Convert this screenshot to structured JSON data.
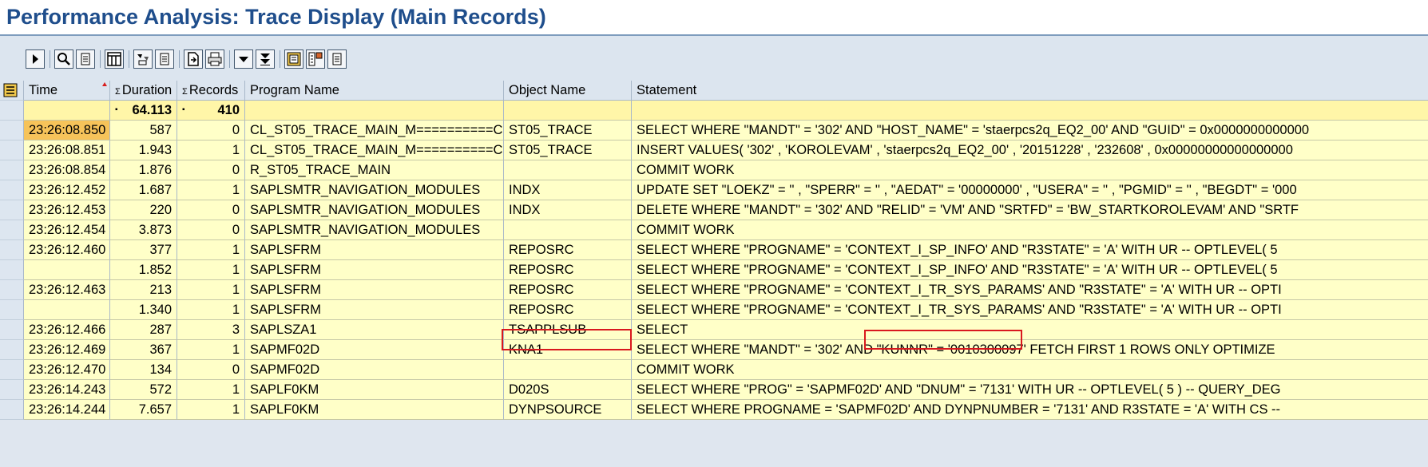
{
  "window": {
    "title": "Performance Analysis: Trace Display (Main Records)"
  },
  "toolbar": {
    "buttons": [
      "execute-icon",
      "details-icon",
      "layout-icon",
      "filter-icon",
      "export-icon",
      "print-icon",
      "dropdown-icon",
      "expand-all-icon",
      "chart-icon",
      "settings-icon"
    ]
  },
  "table": {
    "columns": {
      "time": "Time",
      "duration": "Duration",
      "records": "Records",
      "program": "Program Name",
      "object": "Object Name",
      "statement": "Statement"
    },
    "totals": {
      "duration": "64.113",
      "records": "410"
    },
    "rows": [
      {
        "time": "23:26:08.850",
        "duration": "587",
        "records": "0",
        "program": "CL_ST05_TRACE_MAIN_M==========CP",
        "object": "ST05_TRACE",
        "statement": "SELECT  WHERE \"MANDT\" = '302' AND \"HOST_NAME\" = 'staerpcs2q_EQ2_00' AND \"GUID\" = 0x0000000000000"
      },
      {
        "time": "23:26:08.851",
        "duration": "1.943",
        "records": "1",
        "program": "CL_ST05_TRACE_MAIN_M==========CP",
        "object": "ST05_TRACE",
        "statement": "INSERT  VALUES( '302' , 'KOROLEVAM' , 'staerpcs2q_EQ2_00' , '20151228' , '232608' , 0x00000000000000000"
      },
      {
        "time": "23:26:08.854",
        "duration": "1.876",
        "records": "0",
        "program": "R_ST05_TRACE_MAIN",
        "object": "",
        "statement": "COMMIT WORK"
      },
      {
        "time": "23:26:12.452",
        "duration": "1.687",
        "records": "1",
        "program": "SAPLSMTR_NAVIGATION_MODULES",
        "object": "INDX",
        "statement": "UPDATE  SET \"LOEKZ\" = '' , \"SPERR\" = '' , \"AEDAT\" = '00000000' , \"USERA\" = '' , \"PGMID\" = '' , \"BEGDT\" = '000"
      },
      {
        "time": "23:26:12.453",
        "duration": "220",
        "records": "0",
        "program": "SAPLSMTR_NAVIGATION_MODULES",
        "object": "INDX",
        "statement": "DELETE  WHERE \"MANDT\" = '302' AND \"RELID\" = 'VM' AND \"SRTFD\" = 'BW_STARTKOROLEVAM' AND \"SRTF"
      },
      {
        "time": "23:26:12.454",
        "duration": "3.873",
        "records": "0",
        "program": "SAPLSMTR_NAVIGATION_MODULES",
        "object": "",
        "statement": "COMMIT WORK"
      },
      {
        "time": "23:26:12.460",
        "duration": "377",
        "records": "1",
        "program": "SAPLSFRM",
        "object": "REPOSRC",
        "statement": "SELECT  WHERE \"PROGNAME\" = 'CONTEXT_I_SP_INFO' AND \"R3STATE\" = 'A'    WITH UR -- OPTLEVEL( 5"
      },
      {
        "time": "",
        "duration": "1.852",
        "records": "1",
        "program": "SAPLSFRM",
        "object": "REPOSRC",
        "statement": "SELECT  WHERE \"PROGNAME\" = 'CONTEXT_I_SP_INFO' AND \"R3STATE\" = 'A'    WITH UR -- OPTLEVEL( 5"
      },
      {
        "time": "23:26:12.463",
        "duration": "213",
        "records": "1",
        "program": "SAPLSFRM",
        "object": "REPOSRC",
        "statement": "SELECT  WHERE \"PROGNAME\" = 'CONTEXT_I_TR_SYS_PARAMS' AND \"R3STATE\" = 'A'    WITH UR -- OPTI"
      },
      {
        "time": "",
        "duration": "1.340",
        "records": "1",
        "program": "SAPLSFRM",
        "object": "REPOSRC",
        "statement": "SELECT  WHERE \"PROGNAME\" = 'CONTEXT_I_TR_SYS_PARAMS' AND \"R3STATE\" = 'A'    WITH UR -- OPTI"
      },
      {
        "time": "23:26:12.466",
        "duration": "287",
        "records": "3",
        "program": "SAPLSZA1",
        "object": "TSAPPLSUB",
        "statement": "SELECT"
      },
      {
        "time": "23:26:12.469",
        "duration": "367",
        "records": "1",
        "program": "SAPMF02D",
        "object": "KNA1",
        "statement": "SELECT  WHERE \"MANDT\" = '302' AND \"KUNNR\" = '0010300097'  FETCH FIRST 1 ROWS ONLY OPTIMIZE"
      },
      {
        "time": "23:26:12.470",
        "duration": "134",
        "records": "0",
        "program": "SAPMF02D",
        "object": "",
        "statement": "COMMIT WORK"
      },
      {
        "time": "23:26:14.243",
        "duration": "572",
        "records": "1",
        "program": "SAPLF0KM",
        "object": "D020S",
        "statement": "SELECT  WHERE \"PROG\" = 'SAPMF02D' AND \"DNUM\" = '7131'   WITH UR -- OPTLEVEL( 5 ) -- QUERY_DEG"
      },
      {
        "time": "23:26:14.244",
        "duration": "7.657",
        "records": "1",
        "program": "SAPLF0KM",
        "object": "DYNPSOURCE",
        "statement": "SELECT  WHERE PROGNAME = 'SAPMF02D' AND DYNPNUMBER = '7131'  AND R3STATE = 'A'  WITH CS --"
      }
    ]
  },
  "colors": {
    "title": "#1f4e8c",
    "row_background": "#ffffc8",
    "totals_background": "#fff6a8",
    "selected_time": "#f6c35a",
    "highlight_box": "#d9181e"
  }
}
